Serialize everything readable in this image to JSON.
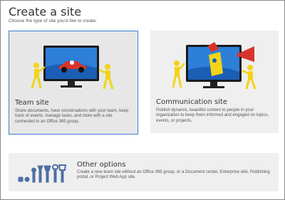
{
  "header": {
    "title": "Create a site",
    "subtitle": "Choose the type of site you'd like to create."
  },
  "options": {
    "team": {
      "title": "Team site",
      "description": "Share documents, have conversations with your team, keep track of events, manage tasks, and more with a site connected to an Office 365 group."
    },
    "communication": {
      "title": "Communication site",
      "description": "Publish dynamic, beautiful content to people in your organization to keep them informed and engaged on topics, events, or projects."
    },
    "other": {
      "title": "Other options",
      "description": "Create a new team site without an Office 365 group, or a Document center, Enterprise wiki, Publishing portal, or Project Web App site."
    }
  },
  "colors": {
    "selected_border": "#3a7fd5",
    "card_bg": "#efefef",
    "screen_blue": "#1f6fd1",
    "figure_yellow": "#f3d416",
    "accent_red": "#d7342a",
    "tool_blue": "#4d6fa3"
  }
}
